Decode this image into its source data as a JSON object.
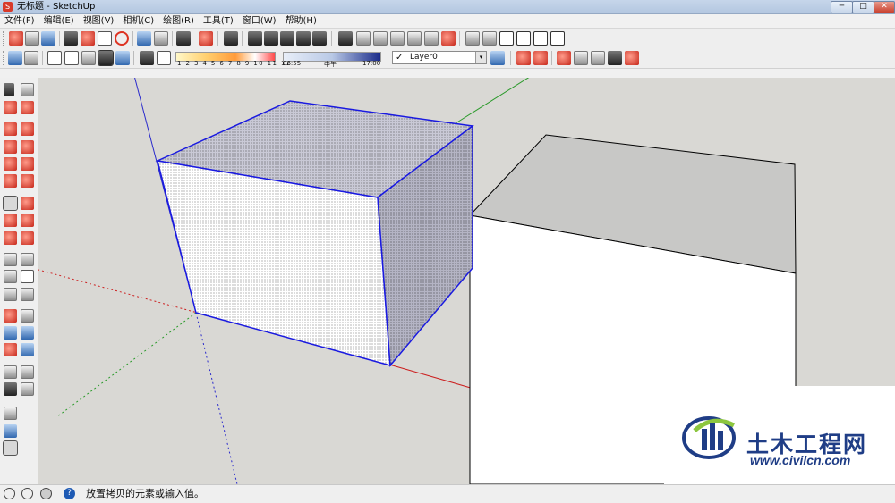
{
  "window": {
    "title": "无标题 - SketchUp",
    "icon": "sketchup-icon",
    "minimize": "─",
    "maximize": "□",
    "close": "✕"
  },
  "menu": [
    "文件(F)",
    "编辑(E)",
    "视图(V)",
    "相机(C)",
    "绘图(R)",
    "工具(T)",
    "窗口(W)",
    "帮助(H)"
  ],
  "shadow": {
    "month_ticks": "1 2 3 4 5 6 7 8 9 10 11 12",
    "time_start": "06:55",
    "time_mid": "中午",
    "time_end": "17:00"
  },
  "layer": {
    "check": "✓",
    "name": "Layer0",
    "dropdown": "▾"
  },
  "status": {
    "message": "放置拷贝的元素或输入值。",
    "help_icon": "?"
  },
  "watermark": {
    "cn_text": "土木工程网",
    "url": "www.civilcn.com"
  },
  "colors": {
    "selection_edge": "#1a1ae0",
    "axis_red": "#cc2020",
    "axis_green": "#2a9a2a",
    "axis_blue": "#2a2acc",
    "sky": "#d9d8d4",
    "brand_blue": "#1f3d86"
  }
}
